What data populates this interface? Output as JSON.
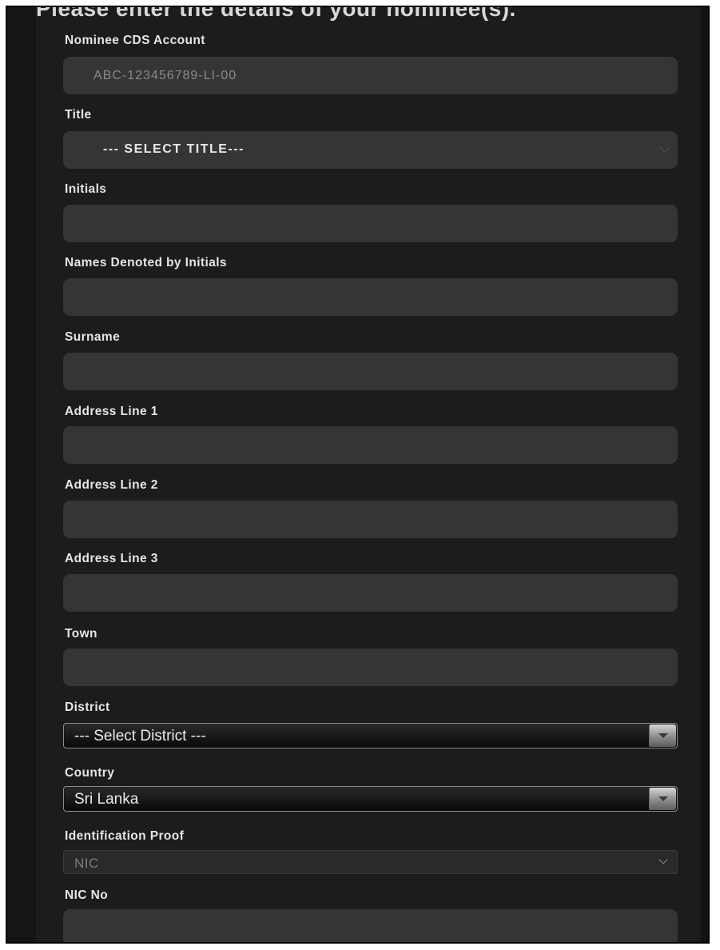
{
  "form": {
    "heading": "Please enter the details of your nominee(s).",
    "nominee_cds_account": {
      "label": "Nominee CDS Account",
      "placeholder": "ABC-123456789-LI-00",
      "value": ""
    },
    "title": {
      "label": "Title",
      "selected": "--- SELECT TITLE---"
    },
    "initials": {
      "label": "Initials",
      "value": ""
    },
    "names_denoted_by_initials": {
      "label": "Names Denoted by Initials",
      "value": ""
    },
    "surname": {
      "label": "Surname",
      "value": ""
    },
    "address_line_1": {
      "label": "Address Line 1",
      "value": ""
    },
    "address_line_2": {
      "label": "Address Line 2",
      "value": ""
    },
    "address_line_3": {
      "label": "Address Line 3",
      "value": ""
    },
    "town": {
      "label": "Town",
      "value": ""
    },
    "district": {
      "label": "District",
      "selected": "--- Select District ---"
    },
    "country": {
      "label": "Country",
      "selected": "Sri Lanka"
    },
    "identification_proof": {
      "label": "Identification Proof",
      "selected": "NIC"
    },
    "nic_no": {
      "label": "NIC No",
      "value": ""
    }
  },
  "icons": {
    "title_caret": "chevron-down-icon",
    "district_caret": "triangle-down-icon",
    "country_caret": "triangle-down-icon",
    "identification_caret": "chevron-down-icon"
  },
  "colors": {
    "page_background": "#151515",
    "panel_background": "#1c1c1c",
    "field_background": "#353535",
    "label_text": "#e6e6e6",
    "placeholder_text": "#8a8a8a",
    "disabled_text": "#7d7d7d"
  }
}
